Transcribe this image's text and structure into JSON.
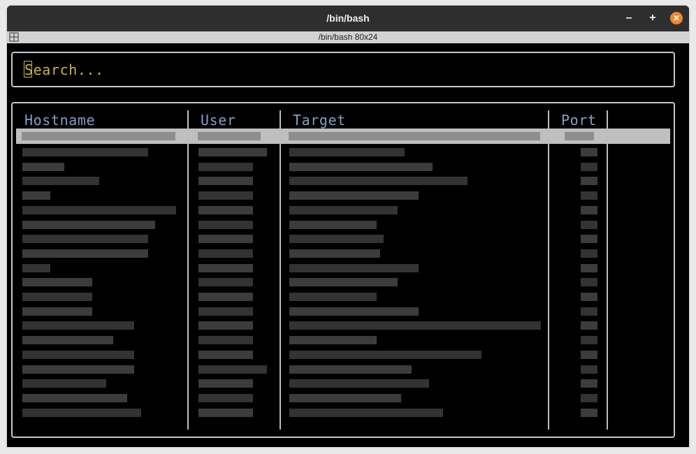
{
  "window": {
    "title": "/bin/bash",
    "tab_title": "/bin/bash 80x24",
    "controls": {
      "minimize": "–",
      "maximize": "+",
      "close": "✕"
    }
  },
  "search": {
    "text": "Search..."
  },
  "table": {
    "columns": [
      "Hostname",
      "User",
      "Target",
      "Port"
    ],
    "selected_row": 0,
    "row_count": 20,
    "rows_content": "redacted"
  },
  "colors": {
    "header_text": "#7f9fc7",
    "search_text": "#c9b24a",
    "selected_row_bg": "#bfbfbf",
    "close_button": "#f2862b"
  }
}
